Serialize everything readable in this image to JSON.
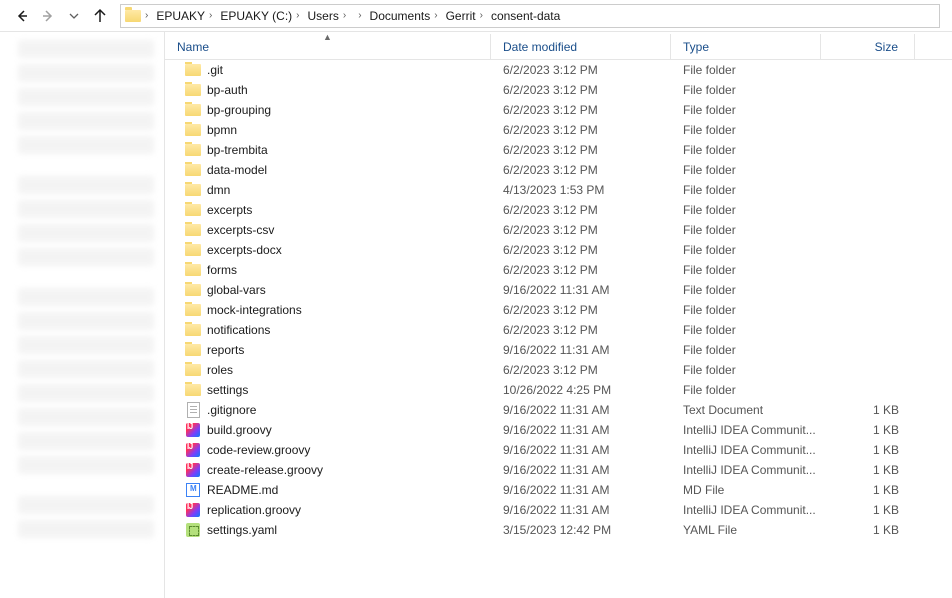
{
  "breadcrumbs": [
    "EPUAKY",
    "EPUAKY (C:)",
    "Users",
    " ",
    "Documents",
    "Gerrit",
    "consent-data"
  ],
  "columns": {
    "name": "Name",
    "date": "Date modified",
    "type": "Type",
    "size": "Size"
  },
  "sort": {
    "column": "name",
    "dir": "asc"
  },
  "rows": [
    {
      "icon": "folder",
      "name": ".git",
      "date": "6/2/2023 3:12 PM",
      "type": "File folder",
      "size": ""
    },
    {
      "icon": "folder",
      "name": "bp-auth",
      "date": "6/2/2023 3:12 PM",
      "type": "File folder",
      "size": ""
    },
    {
      "icon": "folder",
      "name": "bp-grouping",
      "date": "6/2/2023 3:12 PM",
      "type": "File folder",
      "size": ""
    },
    {
      "icon": "folder",
      "name": "bpmn",
      "date": "6/2/2023 3:12 PM",
      "type": "File folder",
      "size": ""
    },
    {
      "icon": "folder",
      "name": "bp-trembita",
      "date": "6/2/2023 3:12 PM",
      "type": "File folder",
      "size": ""
    },
    {
      "icon": "folder",
      "name": "data-model",
      "date": "6/2/2023 3:12 PM",
      "type": "File folder",
      "size": ""
    },
    {
      "icon": "folder",
      "name": "dmn",
      "date": "4/13/2023 1:53 PM",
      "type": "File folder",
      "size": ""
    },
    {
      "icon": "folder",
      "name": "excerpts",
      "date": "6/2/2023 3:12 PM",
      "type": "File folder",
      "size": ""
    },
    {
      "icon": "folder",
      "name": "excerpts-csv",
      "date": "6/2/2023 3:12 PM",
      "type": "File folder",
      "size": ""
    },
    {
      "icon": "folder",
      "name": "excerpts-docx",
      "date": "6/2/2023 3:12 PM",
      "type": "File folder",
      "size": ""
    },
    {
      "icon": "folder",
      "name": "forms",
      "date": "6/2/2023 3:12 PM",
      "type": "File folder",
      "size": ""
    },
    {
      "icon": "folder",
      "name": "global-vars",
      "date": "9/16/2022 11:31 AM",
      "type": "File folder",
      "size": ""
    },
    {
      "icon": "folder",
      "name": "mock-integrations",
      "date": "6/2/2023 3:12 PM",
      "type": "File folder",
      "size": ""
    },
    {
      "icon": "folder",
      "name": "notifications",
      "date": "6/2/2023 3:12 PM",
      "type": "File folder",
      "size": ""
    },
    {
      "icon": "folder",
      "name": "reports",
      "date": "9/16/2022 11:31 AM",
      "type": "File folder",
      "size": ""
    },
    {
      "icon": "folder",
      "name": "roles",
      "date": "6/2/2023 3:12 PM",
      "type": "File folder",
      "size": ""
    },
    {
      "icon": "folder",
      "name": "settings",
      "date": "10/26/2022 4:25 PM",
      "type": "File folder",
      "size": ""
    },
    {
      "icon": "txt",
      "name": ".gitignore",
      "date": "9/16/2022 11:31 AM",
      "type": "Text Document",
      "size": "1 KB"
    },
    {
      "icon": "ij",
      "name": "build.groovy",
      "date": "9/16/2022 11:31 AM",
      "type": "IntelliJ IDEA Communit...",
      "size": "1 KB"
    },
    {
      "icon": "ij",
      "name": "code-review.groovy",
      "date": "9/16/2022 11:31 AM",
      "type": "IntelliJ IDEA Communit...",
      "size": "1 KB"
    },
    {
      "icon": "ij",
      "name": "create-release.groovy",
      "date": "9/16/2022 11:31 AM",
      "type": "IntelliJ IDEA Communit...",
      "size": "1 KB"
    },
    {
      "icon": "md",
      "name": "README.md",
      "date": "9/16/2022 11:31 AM",
      "type": "MD File",
      "size": "1 KB"
    },
    {
      "icon": "ij",
      "name": "replication.groovy",
      "date": "9/16/2022 11:31 AM",
      "type": "IntelliJ IDEA Communit...",
      "size": "1 KB"
    },
    {
      "icon": "yaml",
      "name": "settings.yaml",
      "date": "3/15/2023 12:42 PM",
      "type": "YAML File",
      "size": "1 KB"
    }
  ]
}
